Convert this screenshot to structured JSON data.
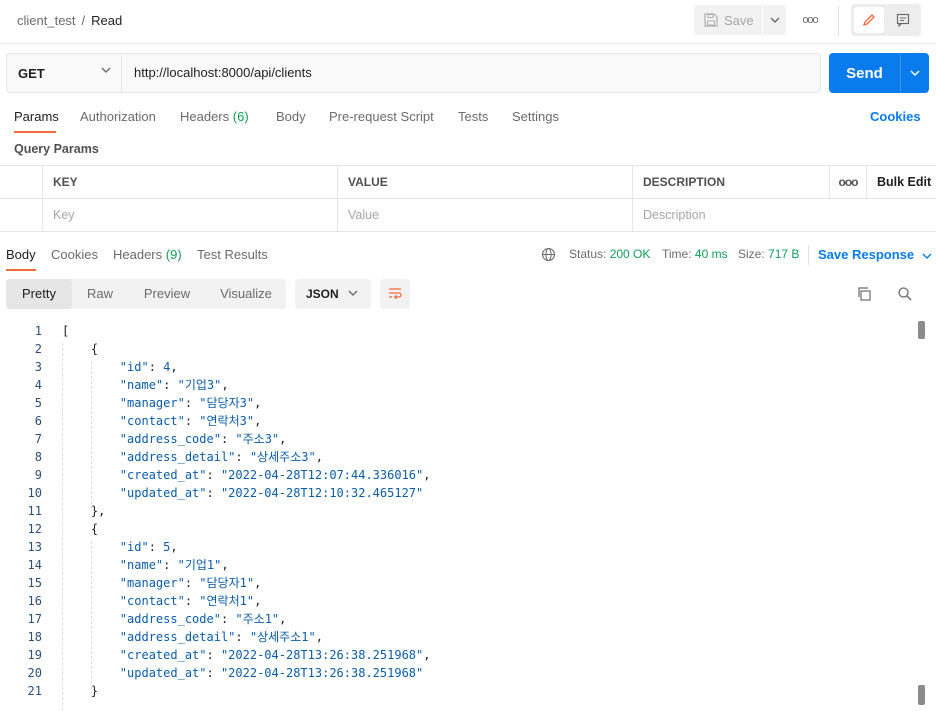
{
  "breadcrumb": {
    "collection": "client_test",
    "separator": "/",
    "request": "Read"
  },
  "toolbar": {
    "save_label": "Save",
    "more_label": "ooo"
  },
  "request": {
    "method": "GET",
    "url": "http://localhost:8000/api/clients",
    "send_label": "Send"
  },
  "request_tabs": {
    "params": "Params",
    "authorization": "Authorization",
    "headers": "Headers",
    "headers_count": "(6)",
    "body": "Body",
    "prerequest": "Pre-request Script",
    "tests": "Tests",
    "settings": "Settings",
    "cookies": "Cookies"
  },
  "query_params": {
    "title": "Query Params",
    "columns": {
      "key": "KEY",
      "value": "VALUE",
      "description": "DESCRIPTION",
      "more": "ooo",
      "bulk": "Bulk Edit"
    },
    "placeholders": {
      "key": "Key",
      "value": "Value",
      "description": "Description"
    }
  },
  "response_tabs": {
    "body": "Body",
    "cookies": "Cookies",
    "headers": "Headers",
    "headers_count": "(9)",
    "test_results": "Test Results"
  },
  "status": {
    "status_label": "Status:",
    "status_value": "200 OK",
    "time_label": "Time:",
    "time_value": "40 ms",
    "size_label": "Size:",
    "size_value": "717 B",
    "save_response": "Save Response"
  },
  "format": {
    "pretty": "Pretty",
    "raw": "Raw",
    "preview": "Preview",
    "visualize": "Visualize",
    "language": "JSON"
  },
  "colors": {
    "accent": "#097bed",
    "tab_underline": "#f26b3a",
    "status_ok": "#0f9d58"
  },
  "code_lines": [
    {
      "n": "1",
      "t": "["
    },
    {
      "n": "2",
      "t": "    {"
    },
    {
      "n": "3",
      "t": "        \"id\": 4,"
    },
    {
      "n": "4",
      "t": "        \"name\": \"기업3\","
    },
    {
      "n": "5",
      "t": "        \"manager\": \"담당자3\","
    },
    {
      "n": "6",
      "t": "        \"contact\": \"연락처3\","
    },
    {
      "n": "7",
      "t": "        \"address_code\": \"주소3\","
    },
    {
      "n": "8",
      "t": "        \"address_detail\": \"상세주소3\","
    },
    {
      "n": "9",
      "t": "        \"created_at\": \"2022-04-28T12:07:44.336016\","
    },
    {
      "n": "10",
      "t": "        \"updated_at\": \"2022-04-28T12:10:32.465127\""
    },
    {
      "n": "11",
      "t": "    },"
    },
    {
      "n": "12",
      "t": "    {"
    },
    {
      "n": "13",
      "t": "        \"id\": 5,"
    },
    {
      "n": "14",
      "t": "        \"name\": \"기업1\","
    },
    {
      "n": "15",
      "t": "        \"manager\": \"담당자1\","
    },
    {
      "n": "16",
      "t": "        \"contact\": \"연락처1\","
    },
    {
      "n": "17",
      "t": "        \"address_code\": \"주소1\","
    },
    {
      "n": "18",
      "t": "        \"address_detail\": \"상세주소1\","
    },
    {
      "n": "19",
      "t": "        \"created_at\": \"2022-04-28T13:26:38.251968\","
    },
    {
      "n": "20",
      "t": "        \"updated_at\": \"2022-04-28T13:26:38.251968\""
    },
    {
      "n": "21",
      "t": "    }"
    }
  ]
}
